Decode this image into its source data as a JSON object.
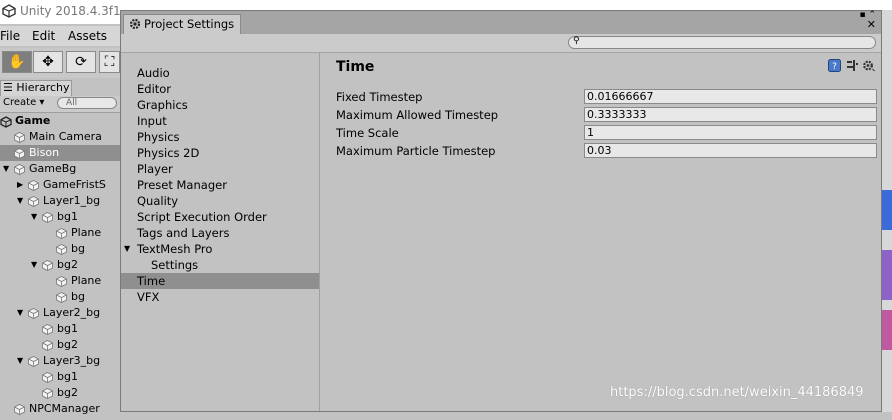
{
  "app": {
    "title": "Unity 2018.4.3f1",
    "menu": [
      "File",
      "Edit",
      "Assets"
    ]
  },
  "hierarchy": {
    "tab_label": "Hierarchy",
    "create_label": "Create",
    "search_placeholder": "All",
    "items": [
      {
        "label": "Game",
        "depth": 0,
        "expanded": true,
        "scene": true
      },
      {
        "label": "Main Camera",
        "depth": 1
      },
      {
        "label": "Bison",
        "depth": 1,
        "selected": true
      },
      {
        "label": "GameBg",
        "depth": 1,
        "expanded": true
      },
      {
        "label": "GameFristS",
        "depth": 2,
        "collapsed": true
      },
      {
        "label": "Layer1_bg",
        "depth": 2,
        "expanded": true
      },
      {
        "label": "bg1",
        "depth": 3,
        "expanded": true
      },
      {
        "label": "Plane",
        "depth": 4
      },
      {
        "label": "bg",
        "depth": 4
      },
      {
        "label": "bg2",
        "depth": 3,
        "expanded": true
      },
      {
        "label": "Plane",
        "depth": 4
      },
      {
        "label": "bg",
        "depth": 4
      },
      {
        "label": "Layer2_bg",
        "depth": 2,
        "expanded": true
      },
      {
        "label": "bg1",
        "depth": 3
      },
      {
        "label": "bg2",
        "depth": 3
      },
      {
        "label": "Layer3_bg",
        "depth": 2,
        "expanded": true
      },
      {
        "label": "bg1",
        "depth": 3
      },
      {
        "label": "bg2",
        "depth": 3
      },
      {
        "label": "NPCManager",
        "depth": 1
      }
    ]
  },
  "window": {
    "tab_label": "Project Settings",
    "nav": [
      {
        "label": "Audio"
      },
      {
        "label": "Editor"
      },
      {
        "label": "Graphics"
      },
      {
        "label": "Input"
      },
      {
        "label": "Physics"
      },
      {
        "label": "Physics 2D"
      },
      {
        "label": "Player"
      },
      {
        "label": "Preset Manager"
      },
      {
        "label": "Quality"
      },
      {
        "label": "Script Execution Order"
      },
      {
        "label": "Tags and Layers"
      },
      {
        "label": "TextMesh Pro",
        "expanded": true
      },
      {
        "label": "Settings",
        "child": true
      },
      {
        "label": "Time",
        "selected": true
      },
      {
        "label": "VFX"
      }
    ],
    "section_title": "Time",
    "properties": [
      {
        "label": "Fixed Timestep",
        "value": "0.01666667"
      },
      {
        "label": "Maximum Allowed Timestep",
        "value": "0.3333333"
      },
      {
        "label": "Time Scale",
        "value": "1"
      },
      {
        "label": "Maximum Particle Timestep",
        "value": "0.03"
      }
    ]
  },
  "watermark": "https://blog.csdn.net/weixin_44186849",
  "colors": {
    "selected_row": "#8f8f8f",
    "panel_bg": "#c2c2c2",
    "field_bg": "#e8e8e8"
  }
}
